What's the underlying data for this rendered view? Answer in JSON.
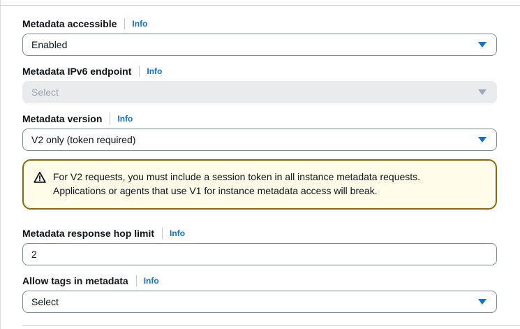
{
  "fields": {
    "metadata_accessible": {
      "label": "Metadata accessible",
      "info": "Info",
      "value": "Enabled"
    },
    "metadata_ipv6": {
      "label": "Metadata IPv6 endpoint",
      "info": "Info",
      "placeholder": "Select"
    },
    "metadata_version": {
      "label": "Metadata version",
      "info": "Info",
      "value": "V2 only (token required)"
    },
    "hop_limit": {
      "label": "Metadata response hop limit",
      "info": "Info",
      "value": "2"
    },
    "allow_tags": {
      "label": "Allow tags in metadata",
      "info": "Info",
      "placeholder": "Select"
    }
  },
  "alert": {
    "line1": "For V2 requests, you must include a session token in all instance metadata requests.",
    "line2": "Applications or agents that use V1 for instance metadata access will break.",
    "icon": "warning-icon"
  },
  "colors": {
    "link": "#0972d3",
    "alert_border": "#8d6605",
    "alert_bg": "#fffce9"
  }
}
